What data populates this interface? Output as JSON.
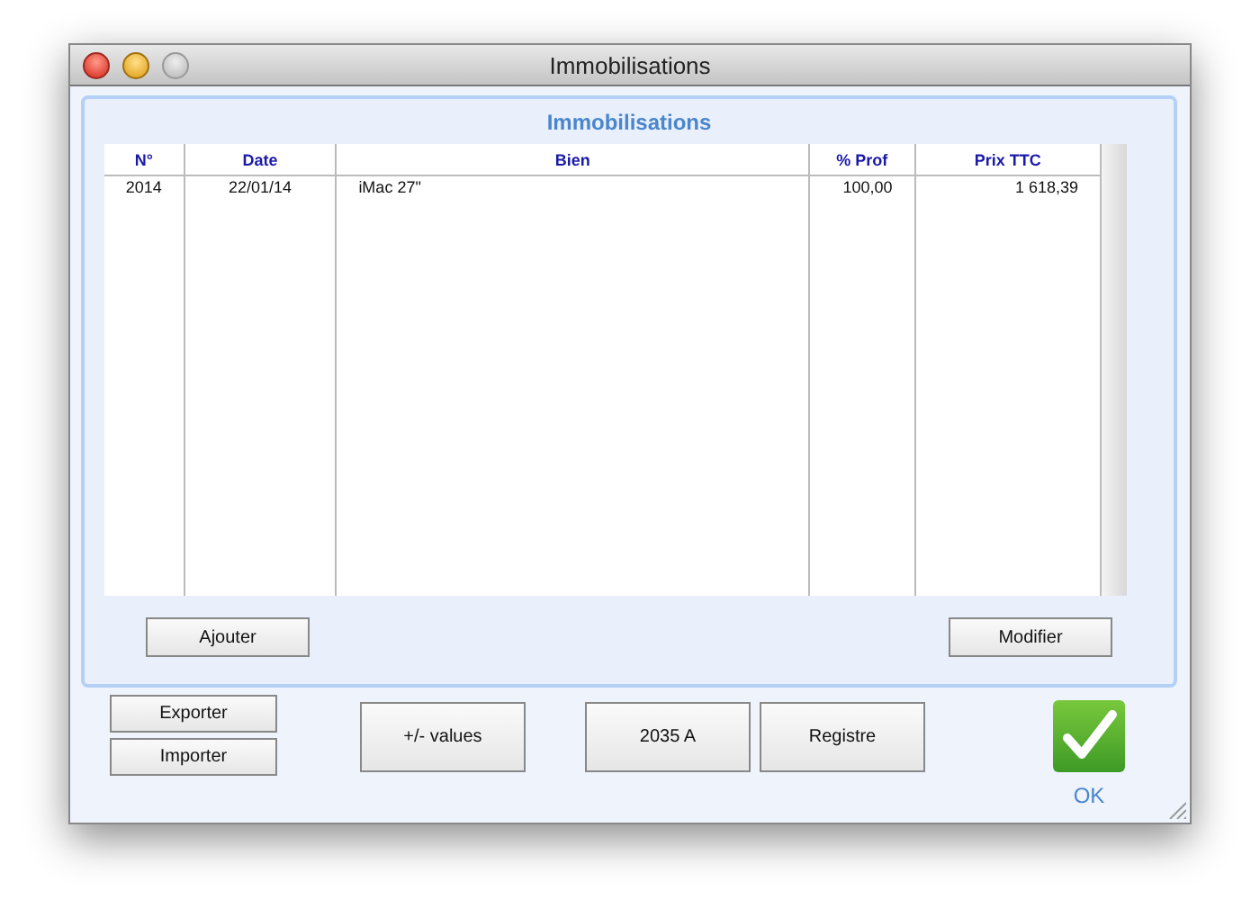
{
  "window": {
    "title": "Immobilisations"
  },
  "panel": {
    "title": "Immobilisations"
  },
  "table": {
    "columns": [
      "N°",
      "Date",
      "Bien",
      "% Prof",
      "Prix TTC"
    ],
    "rows": [
      [
        "2014",
        "22/01/14",
        "iMac 27\"",
        "100,00",
        "1 618,39"
      ]
    ]
  },
  "panel_buttons": [
    "Ajouter",
    "Modifier"
  ],
  "bottom_buttons": {
    "stacked": [
      "Exporter",
      "Importer"
    ],
    "main": [
      "+/- values",
      "2035 A",
      "Registre"
    ],
    "ok": "OK"
  }
}
